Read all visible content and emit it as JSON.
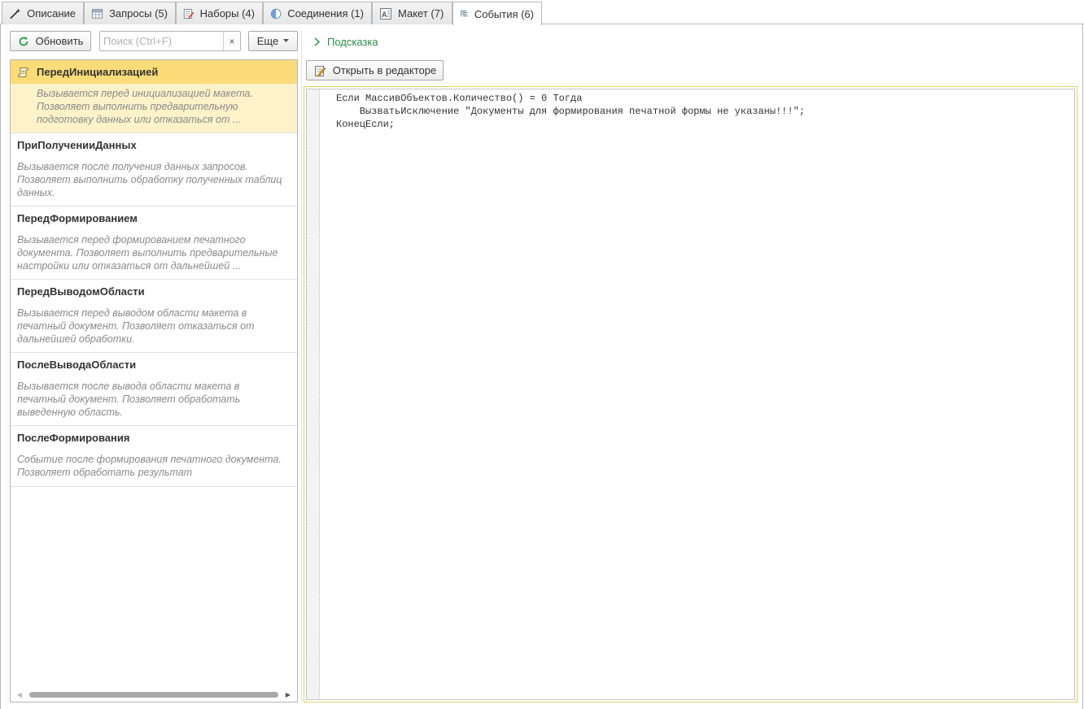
{
  "tabs": [
    {
      "label": "Описание",
      "icon": "wand-icon"
    },
    {
      "label": "Запросы (5)",
      "icon": "table-icon"
    },
    {
      "label": "Наборы (4)",
      "icon": "dataset-icon"
    },
    {
      "label": "Соединения (1)",
      "icon": "join-icon"
    },
    {
      "label": "Макет (7)",
      "icon": "layout-icon"
    },
    {
      "label": "События (6)",
      "icon": "events-icon",
      "active": true
    }
  ],
  "toolbar": {
    "refresh_label": "Обновить",
    "search_placeholder": "Поиск (Ctrl+F)",
    "search_value": "",
    "clear_glyph": "×",
    "more_label": "Еще"
  },
  "events": [
    {
      "name": "ПередИнициализацией",
      "desc": "Вызывается перед инициализацией макета. Позволяет выполнить предварительную подготовку данных или отказаться от ...",
      "active": true
    },
    {
      "name": "ПриПолученииДанных",
      "desc": "Вызывается после получения данных запросов. Позволяет выполнить обработку полученных таблиц данных."
    },
    {
      "name": "ПередФормированием",
      "desc": "Вызывается перед формированием печатного документа. Позволяет выполнить предварительные настройки или отказаться от дальнейшей ..."
    },
    {
      "name": "ПередВыводомОбласти",
      "desc": "Вызывается перед выводом области макета в печатный документ. Позволяет отказаться от дальнейшей обработки."
    },
    {
      "name": "ПослеВыводаОбласти",
      "desc": "Вызывается после вывода области макета в печатный документ. Позволяет обработать выведенную область."
    },
    {
      "name": "ПослеФормирования",
      "desc": "Событие после формирования печатного документа. Позволяет обработать результат"
    }
  ],
  "hint_label": "Подсказка",
  "open_editor_label": "Открыть в редакторе",
  "code": "Если МассивОбъектов.Количество() = 0 Тогда\n    ВызватьИсключение \"Документы для формирования печатной формы не указаны!!!\";\nКонецЕсли;",
  "colors": {
    "active_head": "#fbdc79",
    "active_body": "#fdf2c9",
    "hint_green": "#2c8c4b",
    "editor_border": "#e7cf6b"
  }
}
